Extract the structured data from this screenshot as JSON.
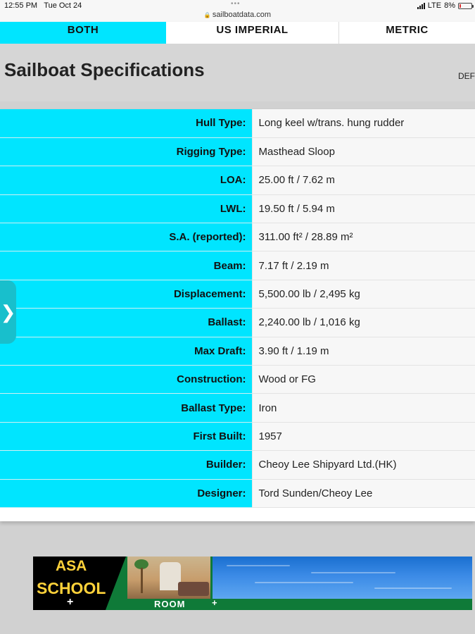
{
  "status_bar": {
    "time": "12:55 PM",
    "date": "Tue Oct 24",
    "url": "sailboatdata.com",
    "network": "LTE",
    "battery": "8%"
  },
  "unit_tabs": [
    {
      "label": "BOTH",
      "active": true
    },
    {
      "label": "US IMPERIAL",
      "active": false
    },
    {
      "label": "METRIC",
      "active": false
    }
  ],
  "page": {
    "title": "Sailboat Specifications",
    "side_tab_label": "DEF"
  },
  "specs": [
    {
      "label": "Hull Type:",
      "value": "Long keel w/trans. hung rudder"
    },
    {
      "label": "Rigging Type:",
      "value": "Masthead Sloop"
    },
    {
      "label": "LOA:",
      "value": "25.00 ft / 7.62 m"
    },
    {
      "label": "LWL:",
      "value": "19.50 ft / 5.94 m"
    },
    {
      "label": "S.A. (reported):",
      "value": "311.00 ft² / 28.89 m²"
    },
    {
      "label": "Beam:",
      "value": "7.17 ft / 2.19 m"
    },
    {
      "label": "Displacement:",
      "value": "5,500.00 lb / 2,495 kg"
    },
    {
      "label": "Ballast:",
      "value": "2,240.00 lb / 1,016 kg"
    },
    {
      "label": "Max Draft:",
      "value": "3.90 ft / 1.19 m"
    },
    {
      "label": "Construction:",
      "value": "Wood or FG"
    },
    {
      "label": "Ballast Type:",
      "value": "Iron"
    },
    {
      "label": "First Built:",
      "value": "1957"
    },
    {
      "label": "Builder:",
      "value": "Cheoy Lee Shipyard Ltd.(HK)"
    },
    {
      "label": "Designer:",
      "value": "Tord Sunden/Cheoy Lee"
    }
  ],
  "side_handle": {
    "glyph": "❯"
  },
  "ad": {
    "line1": "ASA",
    "line2": "SCHOOL",
    "plus": "+",
    "room": "ROOM",
    "plus2": "+"
  },
  "colors": {
    "accent_cyan": "#00e5ff",
    "handle_teal": "#18bfcc",
    "ad_green": "#0f7a38",
    "ad_yellow": "#ffd23a"
  }
}
